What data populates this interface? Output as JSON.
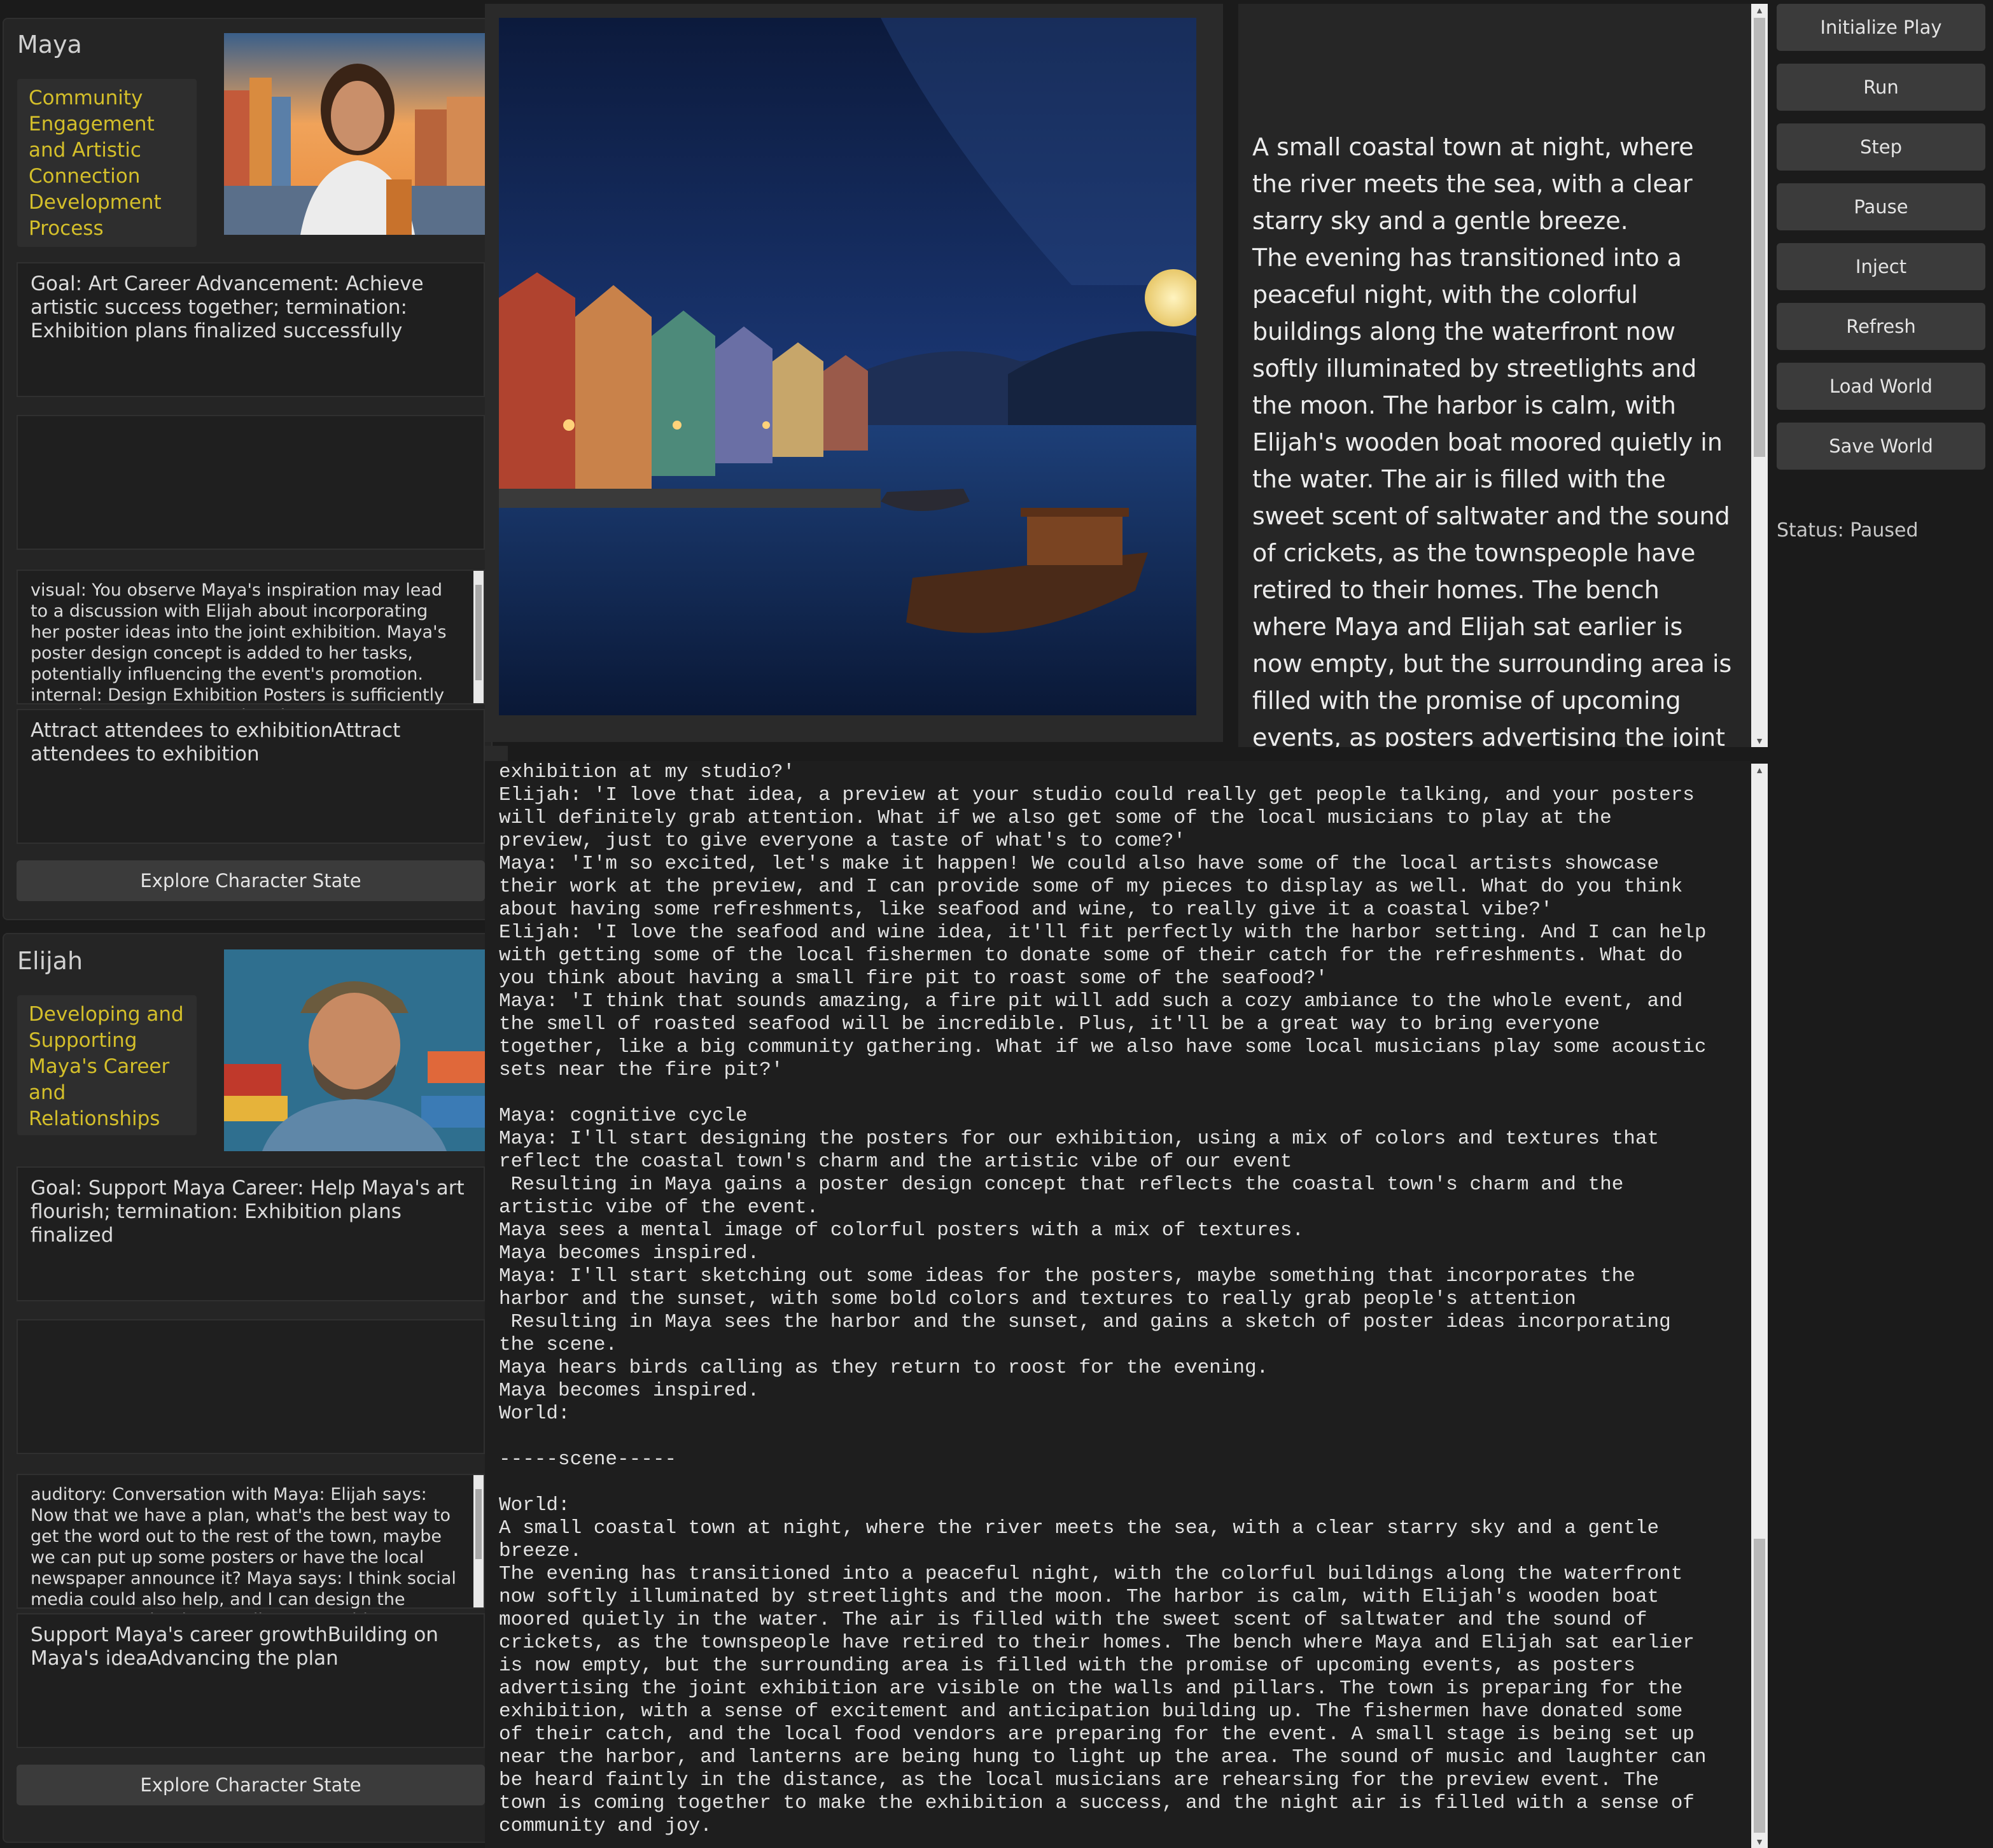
{
  "characters": [
    {
      "name": "Maya",
      "tag": "Community Engagement and Artistic Connection Development Process",
      "goal": "Goal: Art Career Advancement: Achieve artistic success together; termination: Exhibition plans finalized successfully",
      "perception": "visual: You observe Maya's inspiration may lead to a discussion with Elijah about incorporating her poster ideas into the joint exhibition. Maya's poster design concept is added to her tasks, potentially influencing the event's promotion. internal: Design Exhibition Posters is sufficiently complete: Posters are printed",
      "tasks": "Attract attendees to exhibitionAttract attendees to exhibition",
      "explore_label": "Explore Character State"
    },
    {
      "name": "Elijah",
      "tag": "Developing and Supporting Maya's Career and Relationships",
      "goal": "Goal: Support Maya Career: Help Maya's art flourish; termination: Exhibition plans finalized",
      "perception": "auditory: Conversation with Maya: Elijah says: Now that we have a plan, what's the best way to get the word out to the rest of the town, maybe we can put up some posters or have the local newspaper announce it? Maya says: I think social media could also help, and I can design the posters to make them really eye-catching",
      "tasks": "Support Maya's career growthBuilding on Maya's ideaAdvancing the plan",
      "explore_label": "Explore Character State"
    }
  ],
  "scene_description": {
    "paragraph1": "A small coastal town at night, where the river meets the sea, with a clear starry sky and a gentle breeze.",
    "paragraph2": "The evening has transitioned into a peaceful night, with the colorful buildings along the waterfront now softly illuminated by streetlights and the moon. The harbor is calm, with Elijah's wooden boat moored quietly in the water. The air is filled with the sweet scent of saltwater and the sound of crickets, as the townspeople have retired to their homes. The bench where Maya and Elijah sat earlier is now empty, but the surrounding area is filled with the promise of upcoming events, as posters advertising the joint exhibition are visible on the walls and pillars. The town is preparing for the"
  },
  "controls": {
    "buttons": [
      "Initialize Play",
      "Run",
      "Step",
      "Pause",
      "Inject",
      "Refresh",
      "Load World",
      "Save World"
    ],
    "status": "Status: Paused"
  },
  "log_text": "exhibition at my studio?'\nElijah: 'I love that idea, a preview at your studio could really get people talking, and your posters will definitely grab attention. What if we also get some of the local musicians to play at the preview, just to give everyone a taste of what's to come?'\nMaya: 'I'm so excited, let's make it happen! We could also have some of the local artists showcase their work at the preview, and I can provide some of my pieces to display as well. What do you think about having some refreshments, like seafood and wine, to really give it a coastal vibe?'\nElijah: 'I love the seafood and wine idea, it'll fit perfectly with the harbor setting. And I can help with getting some of the local fishermen to donate some of their catch for the refreshments. What do you think about having a small fire pit to roast some of the seafood?'\nMaya: 'I think that sounds amazing, a fire pit will add such a cozy ambiance to the whole event, and the smell of roasted seafood will be incredible. Plus, it'll be a great way to bring everyone together, like a big community gathering. What if we also have some local musicians play some acoustic sets near the fire pit?'\n\nMaya: cognitive cycle\nMaya: I'll start designing the posters for our exhibition, using a mix of colors and textures that reflect the coastal town's charm and the artistic vibe of our event\n Resulting in Maya gains a poster design concept that reflects the coastal town's charm and the artistic vibe of the event.\nMaya sees a mental image of colorful posters with a mix of textures.\nMaya becomes inspired.\nMaya: I'll start sketching out some ideas for the posters, maybe something that incorporates the harbor and the sunset, with some bold colors and textures to really grab people's attention\n Resulting in Maya sees the harbor and the sunset, and gains a sketch of poster ideas incorporating the scene.\nMaya hears birds calling as they return to roost for the evening.\nMaya becomes inspired.\nWorld:\n\n-----scene-----\n\nWorld:\nA small coastal town at night, where the river meets the sea, with a clear starry sky and a gentle breeze.\nThe evening has transitioned into a peaceful night, with the colorful buildings along the waterfront now softly illuminated by streetlights and the moon. The harbor is calm, with Elijah's wooden boat moored quietly in the water. The air is filled with the sweet scent of saltwater and the sound of crickets, as the townspeople have retired to their homes. The bench where Maya and Elijah sat earlier is now empty, but the surrounding area is filled with the promise of upcoming events, as posters advertising the joint exhibition are visible on the walls and pillars. The town is preparing for the exhibition, with a sense of excitement and anticipation building up. The fishermen have donated some of their catch, and the local food vendors are preparing for the event. A small stage is being set up near the harbor, and lanterns are being hung to light up the area. The sound of music and laughter can be heard faintly in the distance, as the local musicians are rehearsing for the preview event. The town is coming together to make the exhibition a success, and the night air is filled with a sense of community and joy.",
  "colors": {
    "background": "#1b1b1b",
    "panel": "#252525",
    "tag_text": "#d4bf2a",
    "button": "#3b3b3b"
  }
}
